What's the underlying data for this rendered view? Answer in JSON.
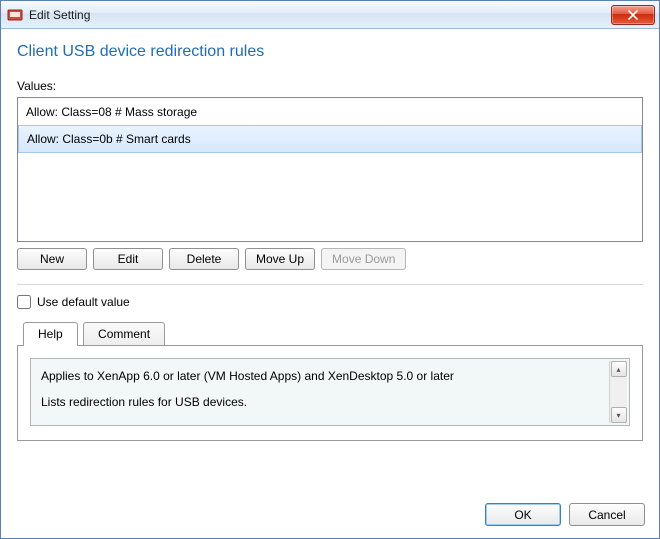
{
  "titlebar": {
    "title": "Edit Setting"
  },
  "policy": {
    "title": "Client USB device redirection rules"
  },
  "values": {
    "label": "Values:",
    "items": [
      {
        "text": "Allow: Class=08 # Mass storage",
        "selected": false
      },
      {
        "text": "Allow: Class=0b # Smart cards",
        "selected": true
      }
    ]
  },
  "buttons": {
    "new": "New",
    "edit": "Edit",
    "delete": "Delete",
    "moveUp": "Move Up",
    "moveDown": "Move Down",
    "moveDownDisabled": true
  },
  "defaultValue": {
    "label": "Use default value",
    "checked": false
  },
  "tabs": {
    "help": "Help",
    "comment": "Comment",
    "active": "help"
  },
  "help": {
    "line1": "Applies to XenApp 6.0 or later (VM Hosted Apps) and XenDesktop 5.0 or later",
    "line2": "Lists redirection rules for USB devices."
  },
  "dialog": {
    "ok": "OK",
    "cancel": "Cancel"
  }
}
